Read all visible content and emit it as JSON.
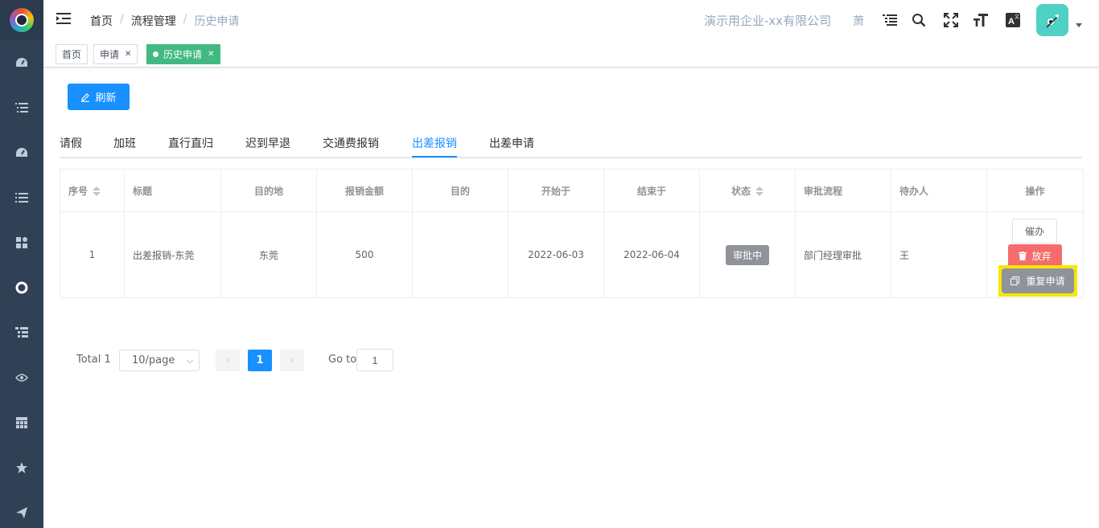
{
  "breadcrumb": [
    "首页",
    "流程管理",
    "历史申请"
  ],
  "navbar": {
    "company": "演示用企业-xx有限公司",
    "user_char": "萧"
  },
  "tags": [
    {
      "label": "首页"
    },
    {
      "label": "申请"
    },
    {
      "label": "历史申请",
      "active": true
    }
  ],
  "toolbar": {
    "refresh_label": "刷新"
  },
  "tabs": [
    "请假",
    "加班",
    "直行直归",
    "迟到早退",
    "交通费报销",
    "出差报销",
    "出差申请"
  ],
  "active_tab": "出差报销",
  "table": {
    "headers": [
      "序号",
      "标题",
      "目的地",
      "报销金额",
      "目的",
      "开始于",
      "结束于",
      "状态",
      "审批流程",
      "待办人",
      "操作"
    ],
    "rows": [
      {
        "index": "1",
        "title": "出差报销-东莞",
        "destination": "东莞",
        "amount": "500",
        "purpose": "",
        "start": "2022-06-03",
        "end": "2022-06-04",
        "status": "审批中",
        "flow": "部门经理审批",
        "assignee": "王",
        "actions": {
          "urge": "催办",
          "abandon": "放弃",
          "reapply": "重复申请"
        }
      }
    ]
  },
  "pagination": {
    "total_label": "Total 1",
    "page_size": "10/page",
    "current_page": "1",
    "goto_label": "Go to",
    "goto_value": "1"
  },
  "colors": {
    "sidebar": "#304156",
    "primary": "#1890ff",
    "tag_active": "#42b983",
    "danger": "#f56c6c",
    "highlight": "#f7e600"
  }
}
